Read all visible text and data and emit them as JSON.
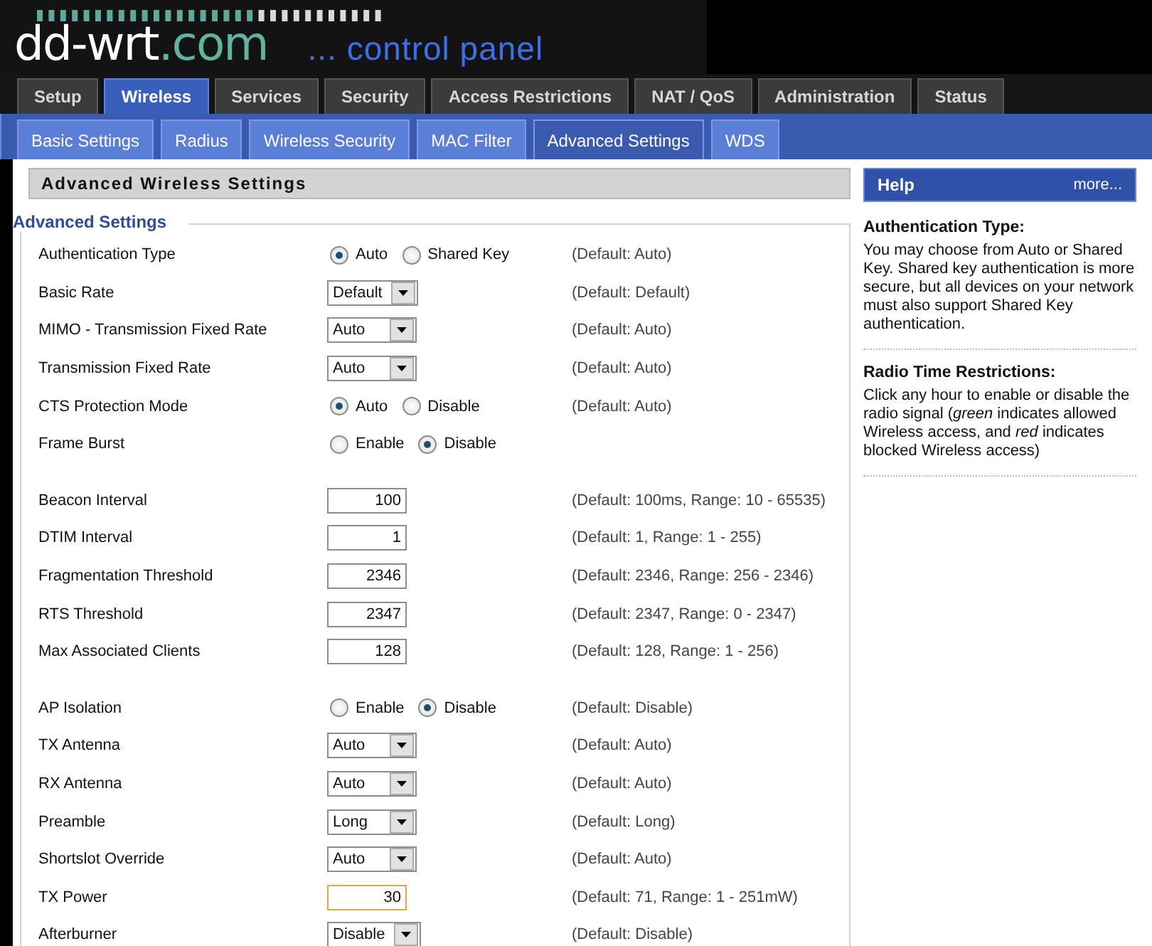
{
  "logo": {
    "name": "dd-wrt",
    "suffix": ".com",
    "tagline": "... control panel"
  },
  "tabs": [
    {
      "label": "Setup",
      "selected": false
    },
    {
      "label": "Wireless",
      "selected": true
    },
    {
      "label": "Services",
      "selected": false
    },
    {
      "label": "Security",
      "selected": false
    },
    {
      "label": "Access Restrictions",
      "selected": false
    },
    {
      "label": "NAT / QoS",
      "selected": false
    },
    {
      "label": "Administration",
      "selected": false
    },
    {
      "label": "Status",
      "selected": false
    }
  ],
  "subtabs": [
    {
      "label": "Basic Settings",
      "selected": false
    },
    {
      "label": "Radius",
      "selected": false
    },
    {
      "label": "Wireless Security",
      "selected": false
    },
    {
      "label": "MAC Filter",
      "selected": false
    },
    {
      "label": "Advanced Settings",
      "selected": true
    },
    {
      "label": "WDS",
      "selected": false
    }
  ],
  "section_title": "Advanced Wireless Settings",
  "fieldset": {
    "legend": "Advanced Settings",
    "groups": [
      {
        "rows": [
          {
            "kind": "radio",
            "label": "Authentication Type",
            "options": [
              {
                "label": "Auto",
                "selected": true
              },
              {
                "label": "Shared Key",
                "selected": false
              }
            ],
            "default": "(Default: Auto)"
          },
          {
            "kind": "select",
            "label": "Basic Rate",
            "value": "Default",
            "default": "(Default: Default)"
          },
          {
            "kind": "select",
            "label": "MIMO - Transmission Fixed Rate",
            "value": "Auto",
            "default": "(Default: Auto)"
          },
          {
            "kind": "select",
            "label": "Transmission Fixed Rate",
            "value": "Auto",
            "default": "(Default: Auto)"
          },
          {
            "kind": "radio",
            "label": "CTS Protection Mode",
            "options": [
              {
                "label": "Auto",
                "selected": true
              },
              {
                "label": "Disable",
                "selected": false
              }
            ],
            "default": "(Default: Auto)"
          },
          {
            "kind": "radio",
            "label": "Frame Burst",
            "options": [
              {
                "label": "Enable",
                "selected": false
              },
              {
                "label": "Disable",
                "selected": true
              }
            ]
          }
        ]
      },
      {
        "rows": [
          {
            "kind": "text",
            "label": "Beacon Interval",
            "value": "100",
            "focused": false,
            "default": "(Default: 100ms, Range: 10 - 65535)"
          },
          {
            "kind": "text",
            "label": "DTIM Interval",
            "value": "1",
            "focused": false,
            "default": "(Default: 1, Range: 1 - 255)"
          },
          {
            "kind": "text",
            "label": "Fragmentation Threshold",
            "value": "2346",
            "focused": false,
            "default": "(Default: 2346, Range: 256 - 2346)"
          },
          {
            "kind": "text",
            "label": "RTS Threshold",
            "value": "2347",
            "focused": false,
            "default": "(Default: 2347, Range: 0 - 2347)"
          },
          {
            "kind": "text",
            "label": "Max Associated Clients",
            "value": "128",
            "focused": false,
            "default": "(Default: 128, Range: 1 - 256)"
          }
        ]
      },
      {
        "rows": [
          {
            "kind": "radio",
            "label": "AP Isolation",
            "options": [
              {
                "label": "Enable",
                "selected": false
              },
              {
                "label": "Disable",
                "selected": true
              }
            ],
            "default": "(Default: Disable)"
          },
          {
            "kind": "select",
            "label": "TX Antenna",
            "value": "Auto",
            "default": "(Default: Auto)"
          },
          {
            "kind": "select",
            "label": "RX Antenna",
            "value": "Auto",
            "default": "(Default: Auto)"
          },
          {
            "kind": "select",
            "label": "Preamble",
            "value": "Long",
            "default": "(Default: Long)"
          },
          {
            "kind": "select",
            "label": "Shortslot Override",
            "value": "Auto",
            "default": "(Default: Auto)"
          },
          {
            "kind": "text",
            "label": "TX Power",
            "value": "30",
            "focused": true,
            "default": "(Default: 71, Range: 1 - 251mW)"
          },
          {
            "kind": "select",
            "label": "Afterburner",
            "value": "Disable",
            "default": "(Default: Disable)"
          }
        ]
      }
    ]
  },
  "help": {
    "title": "Help",
    "more": "more...",
    "entries": [
      {
        "heading": "Authentication Type:",
        "text": "You may choose from Auto or Shared Key. Shared key authentication is more secure, but all devices on your network must also support Shared Key authentication."
      },
      {
        "heading": "Radio Time Restrictions:",
        "text": "Click any hour to enable or disable the radio signal (*green* indicates allowed Wireless access, and *red* indicates blocked Wireless access)"
      }
    ]
  }
}
